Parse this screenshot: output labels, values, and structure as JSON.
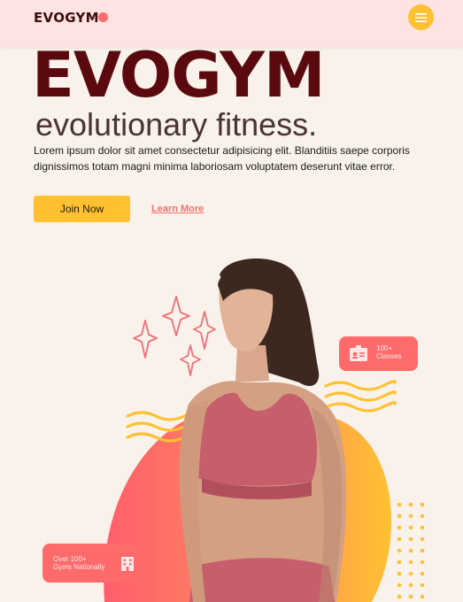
{
  "header": {
    "logo_text": "EVOGYM",
    "menu_icon": "hamburger-menu-icon"
  },
  "hero": {
    "title": "EVOGYM",
    "subtitle": "evolutionary fitness.",
    "description": "Lorem ipsum dolor sit amet consectetur adipisicing elit. Blanditiis saepe corporis dignissimos totam magni minima laboriosam voluptatem deserunt vitae error.",
    "join_label": "Join Now",
    "learn_label": "Learn More"
  },
  "badges": {
    "classes": {
      "line1": "100+",
      "line2": "Classes",
      "icon": "id-card-icon"
    },
    "gyms": {
      "line1": "Over 100+",
      "line2": "Gyms Nationally",
      "icon": "building-icon"
    }
  },
  "colors": {
    "header_bg": "#fde3e1",
    "page_bg": "#f8f2ea",
    "accent_yellow": "#ffc132",
    "accent_coral": "#ff6b6b",
    "title_maroon": "#5a0a0e"
  }
}
